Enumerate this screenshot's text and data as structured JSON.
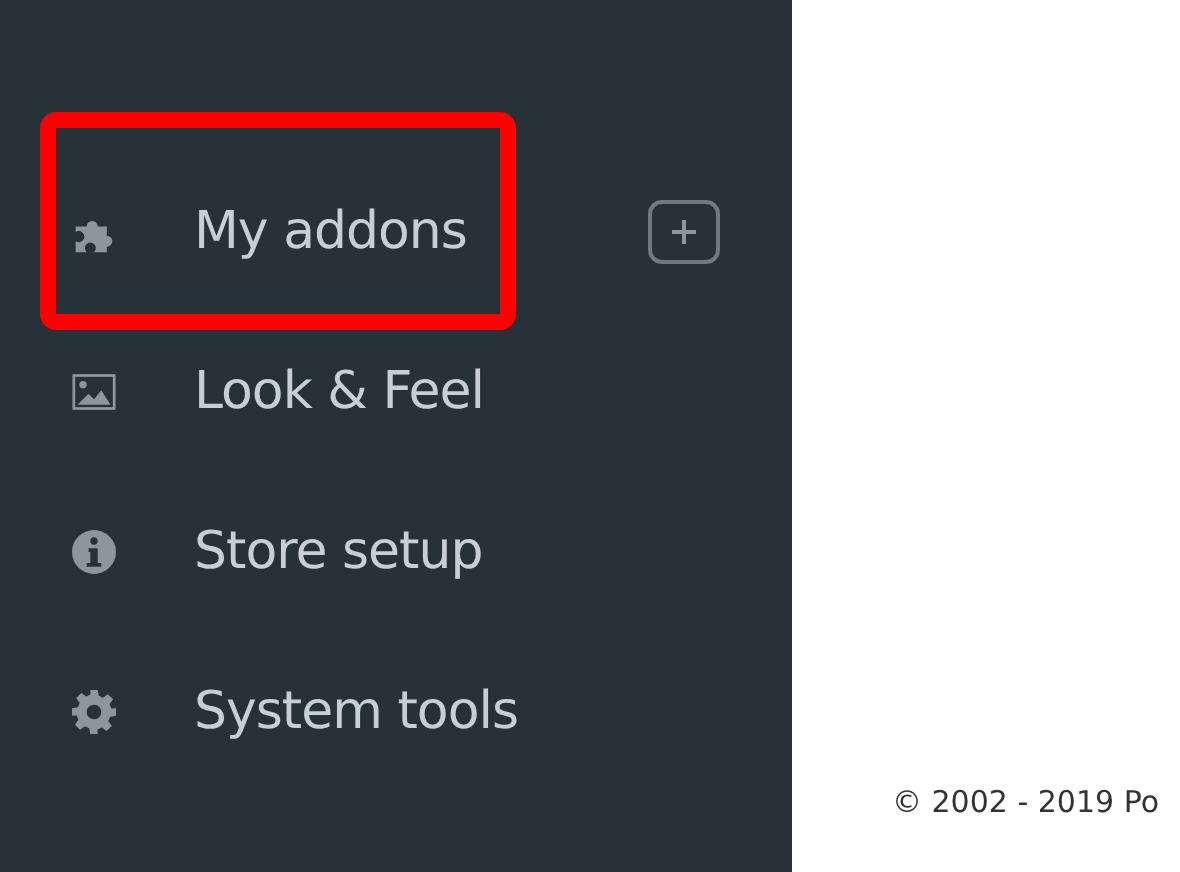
{
  "sidebar": {
    "items": [
      {
        "label": "My addons",
        "highlighted": true,
        "add_button": true
      },
      {
        "label": "Look & Feel",
        "highlighted": false,
        "add_button": false
      },
      {
        "label": "Store setup",
        "highlighted": false,
        "add_button": false
      },
      {
        "label": "System tools",
        "highlighted": false,
        "add_button": false
      }
    ]
  },
  "footer": {
    "copyright": "© 2002 - 2019 Po"
  }
}
